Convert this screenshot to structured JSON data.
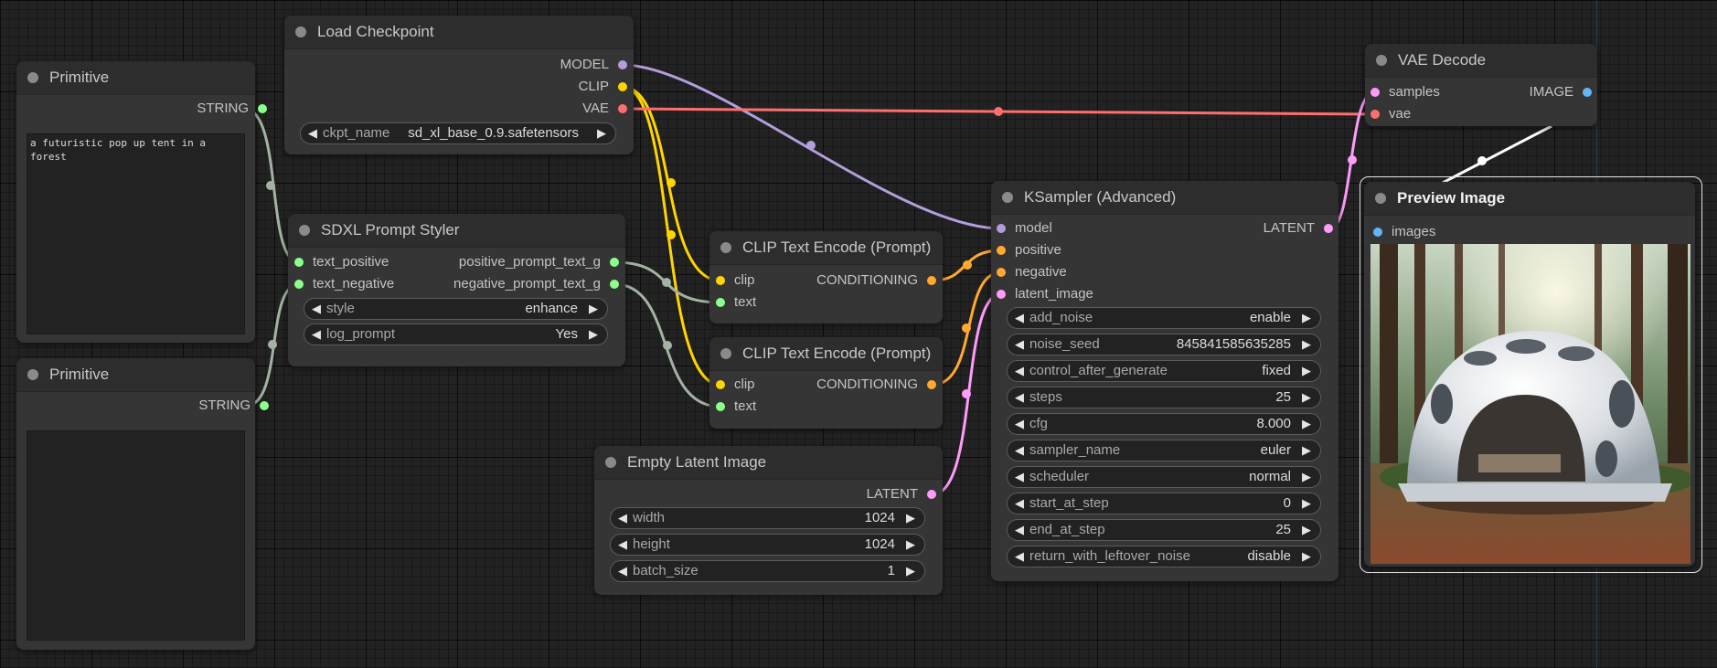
{
  "colors": {
    "model": "#b39ddb",
    "clip": "#ffd500",
    "vae": "#ff6e6e",
    "string": "#8bff8b",
    "conditioning": "#ffa931",
    "latent": "#ff9cf9",
    "image": "#64b5f6",
    "generic": "#a3b3a3"
  },
  "nodes": {
    "load_checkpoint": {
      "title": "Load Checkpoint",
      "outputs": [
        "MODEL",
        "CLIP",
        "VAE"
      ],
      "ckpt_label": "ckpt_name",
      "ckpt_value": "sd_xl_base_0.9.safetensors"
    },
    "primitive1": {
      "title": "Primitive",
      "output": "STRING",
      "text": "a futuristic pop up tent in a forest"
    },
    "primitive2": {
      "title": "Primitive",
      "output": "STRING",
      "text": ""
    },
    "styler": {
      "title": "SDXL Prompt Styler",
      "inputs": [
        "text_positive",
        "text_negative"
      ],
      "outputs": [
        "positive_prompt_text_g",
        "negative_prompt_text_g"
      ],
      "widgets": [
        {
          "label": "style",
          "value": "enhance"
        },
        {
          "label": "log_prompt",
          "value": "Yes"
        }
      ]
    },
    "clip_pos": {
      "title": "CLIP Text Encode (Prompt)",
      "inputs": [
        "clip",
        "text"
      ],
      "output": "CONDITIONING"
    },
    "clip_neg": {
      "title": "CLIP Text Encode (Prompt)",
      "inputs": [
        "clip",
        "text"
      ],
      "output": "CONDITIONING"
    },
    "empty_latent": {
      "title": "Empty Latent Image",
      "output": "LATENT",
      "widgets": [
        {
          "label": "width",
          "value": "1024"
        },
        {
          "label": "height",
          "value": "1024"
        },
        {
          "label": "batch_size",
          "value": "1"
        }
      ]
    },
    "ksampler": {
      "title": "KSampler (Advanced)",
      "inputs": [
        "model",
        "positive",
        "negative",
        "latent_image"
      ],
      "output": "LATENT",
      "widgets": [
        {
          "label": "add_noise",
          "value": "enable"
        },
        {
          "label": "noise_seed",
          "value": "845841585635285"
        },
        {
          "label": "control_after_generate",
          "value": "fixed"
        },
        {
          "label": "steps",
          "value": "25"
        },
        {
          "label": "cfg",
          "value": "8.000"
        },
        {
          "label": "sampler_name",
          "value": "euler"
        },
        {
          "label": "scheduler",
          "value": "normal"
        },
        {
          "label": "start_at_step",
          "value": "0"
        },
        {
          "label": "end_at_step",
          "value": "25"
        },
        {
          "label": "return_with_leftover_noise",
          "value": "disable"
        }
      ]
    },
    "vae_decode": {
      "title": "VAE Decode",
      "inputs": [
        "samples",
        "vae"
      ],
      "output": "IMAGE"
    },
    "preview": {
      "title": "Preview Image",
      "input": "images"
    }
  }
}
